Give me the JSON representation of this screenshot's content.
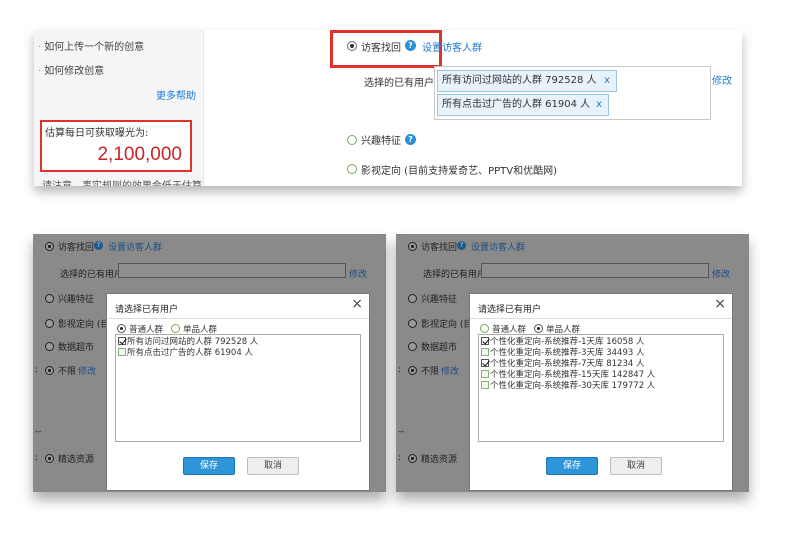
{
  "top": {
    "sidebar": {
      "help_links": [
        "如何上传一个新的创意",
        "如何修改创意"
      ],
      "more_help": "更多帮助",
      "estimate_label": "估算每日可获取曝光为:",
      "estimate_value": "2,100,000",
      "cut_text": "请注意，事实规则的效果会低于估算"
    },
    "main": {
      "option_visitor": "访客找回",
      "help_icon": "?",
      "set_visitor_link": "设置访客人群",
      "existing_users_label": "选择的已有用户:",
      "tags": [
        {
          "label": "所有访问过网站的人群 792528 人",
          "remove": "x"
        },
        {
          "label": "所有点击过广告的人群 61904 人",
          "remove": "x"
        }
      ],
      "modify_link": "修改",
      "option_interest": "兴趣特征",
      "option_video": "影视定向 (目前支持爱奇艺、PPTV和优酷网)"
    }
  },
  "left_panel": {
    "bg": {
      "option_visitor": "访客找回",
      "set_visitor_link": "设置访客人群",
      "existing_users_label": "选择的已有用户:",
      "modify_link": "修改",
      "option_interest": "兴趣特征",
      "option_video": "影视定向 (目",
      "option_data": "数据超市",
      "unlimited": "不限",
      "unlimited_modify": "修改",
      "dashes": "--",
      "selected_resource": "精选资源"
    },
    "dialog": {
      "title": "请选择已有用户",
      "close": "×",
      "radio_normal": "普通人群",
      "radio_single": "单品人群",
      "selected_radio": "normal",
      "items": [
        {
          "label": "所有访问过网站的人群 792528 人",
          "checked": true
        },
        {
          "label": "所有点击过广告的人群 61904 人",
          "checked": false
        }
      ],
      "save": "保存",
      "cancel": "取消"
    }
  },
  "right_panel": {
    "bg": {
      "option_visitor": "访客找回",
      "set_visitor_link": "设置访客人群",
      "existing_users_label": "选择的已有用户:",
      "modify_link": "修改",
      "option_interest": "兴趣特征",
      "option_video": "影视定向 (目",
      "option_data": "数据超市",
      "unlimited": "不限",
      "unlimited_modify": "修改",
      "dashes": "--",
      "selected_resource": "精选资源"
    },
    "dialog": {
      "title": "请选择已有用户",
      "close": "×",
      "radio_normal": "普通人群",
      "radio_single": "单品人群",
      "selected_radio": "single",
      "items": [
        {
          "label": "个性化重定向-系统推荐-1天库 16058 人",
          "checked": true
        },
        {
          "label": "个性化重定向-系统推荐-3天库 34493 人",
          "checked": false
        },
        {
          "label": "个性化重定向-系统推荐-7天库 81234 人",
          "checked": true
        },
        {
          "label": "个性化重定向-系统推荐-15天库 142847 人",
          "checked": false
        },
        {
          "label": "个性化重定向-系统推荐-30天库 179772 人",
          "checked": false
        }
      ],
      "save": "保存",
      "cancel": "取消"
    }
  },
  "colors": {
    "highlight_red": "#e0312d",
    "estimate_red": "#c8242a",
    "link_blue": "#1f7bd2",
    "save_blue": "#2e95d8"
  }
}
